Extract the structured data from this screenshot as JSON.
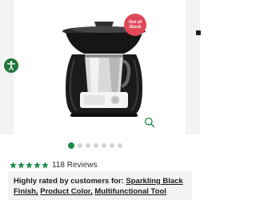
{
  "badge": {
    "line1": "Out of",
    "line2": "Stock",
    "color": "#e0485a"
  },
  "carousel": {
    "image": "Thermomix cooking machine in Sparkling Black",
    "slide_count": 7,
    "active_index": 0,
    "active_color": "#1d8a49"
  },
  "icons": {
    "accessibility": "accessibility-icon",
    "zoom": "magnifier-zoom-icon",
    "star": "star-icon"
  },
  "rating": {
    "stars": 5,
    "star_color": "#1d8a49",
    "count_text": "118 Reviews"
  },
  "highlights": {
    "title": "Highly rated by customers for:",
    "items": [
      "Sparkling Black",
      "Finish,",
      "Product Color,",
      "Multifunctional Tool"
    ]
  }
}
